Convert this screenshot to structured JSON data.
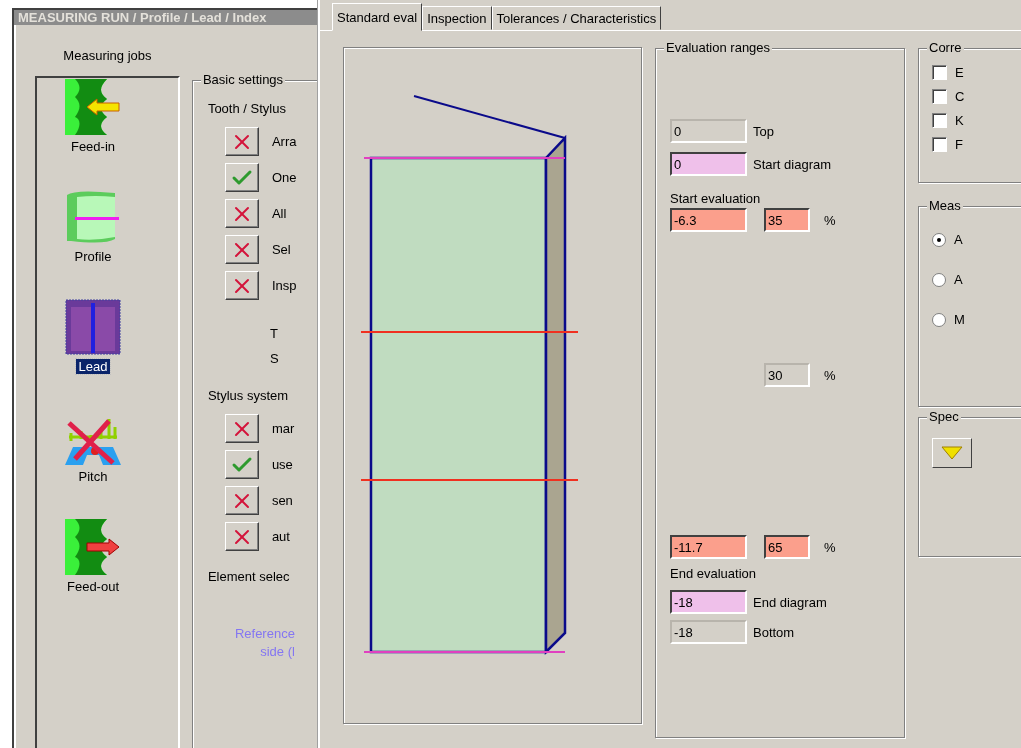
{
  "left_window": {
    "title": "MEASURING RUN / Profile / Lead / Index",
    "jobs_heading": "Measuring jobs",
    "jobs": [
      {
        "label": "Feed-in",
        "selected": false
      },
      {
        "label": "Profile",
        "selected": false
      },
      {
        "label": "Lead",
        "selected": true
      },
      {
        "label": "Pitch",
        "selected": false
      },
      {
        "label": "Feed-out",
        "selected": false
      }
    ],
    "basic_settings": {
      "title": "Basic settings",
      "heading": "Tooth / Stylus",
      "options": [
        {
          "label": "Arra",
          "kind": "cross"
        },
        {
          "label": "One",
          "kind": "tick"
        },
        {
          "label": "All",
          "kind": "cross"
        },
        {
          "label": "Sel",
          "kind": "cross"
        },
        {
          "label": "Insp",
          "kind": "cross"
        }
      ],
      "lines": [
        "T",
        "S"
      ],
      "stylus_heading": "Stylus system",
      "stylus_options": [
        {
          "label": "mar",
          "kind": "cross"
        },
        {
          "label": "use",
          "kind": "tick"
        },
        {
          "label": "sen",
          "kind": "cross"
        },
        {
          "label": "aut",
          "kind": "cross"
        }
      ],
      "element_heading": "Element selec",
      "reference_note": [
        "Reference",
        "side (l"
      ]
    }
  },
  "right_window": {
    "tabs": [
      {
        "label": "Standard eval",
        "selected": true
      },
      {
        "label": "Inspection",
        "selected": false
      },
      {
        "label": "Tolerances / Characteristics",
        "selected": false
      }
    ],
    "evaluation_ranges": {
      "title": "Evaluation ranges",
      "rows": [
        {
          "kind": "limit",
          "value": "0",
          "label": "Top"
        },
        {
          "kind": "diagram",
          "value": "0",
          "label": "Start diagram"
        },
        {
          "kind": "caption",
          "text": "Start evaluation"
        },
        {
          "kind": "evaluation",
          "value": "-6.3",
          "percent": "35",
          "unit": "%"
        },
        {
          "kind": "share",
          "percent": "30",
          "unit": "%"
        },
        {
          "kind": "evaluation",
          "value": "-11.7",
          "percent": "65",
          "unit": "%"
        },
        {
          "kind": "caption",
          "text": "End evaluation"
        },
        {
          "kind": "diagram",
          "value": "-18",
          "label": "End diagram"
        },
        {
          "kind": "limit",
          "value": "-18",
          "label": "Bottom"
        }
      ]
    },
    "corrections": {
      "title": "Corre",
      "items": [
        {
          "label": "E",
          "checked": false
        },
        {
          "label": "C",
          "checked": false
        },
        {
          "label": "K",
          "checked": false
        },
        {
          "label": "F",
          "checked": false
        }
      ]
    },
    "measuring": {
      "title": "Meas",
      "options": [
        {
          "label": "A",
          "selected": true
        },
        {
          "label": "A",
          "selected": false
        },
        {
          "label": "M",
          "selected": false
        }
      ]
    },
    "special": {
      "title": "Spec"
    }
  }
}
